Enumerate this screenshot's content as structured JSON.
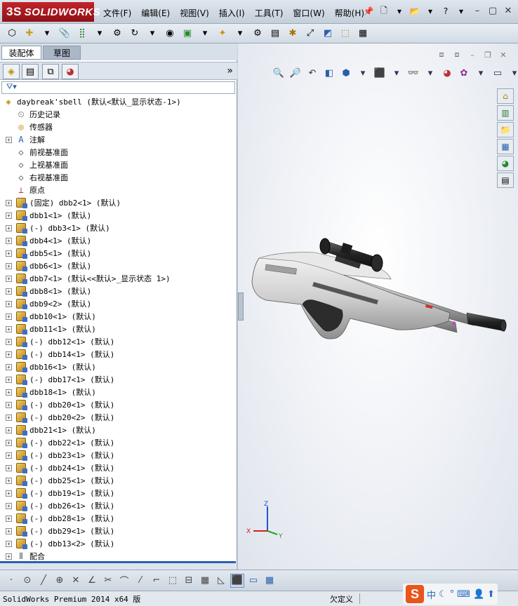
{
  "app": {
    "logo_text": "SOLIDWORKS",
    "logo_prefix": "3S"
  },
  "menu": [
    "文件(F)",
    "编辑(E)",
    "视图(V)",
    "插入(I)",
    "工具(T)",
    "窗口(W)",
    "帮助(H)"
  ],
  "tabs": {
    "assembly": "装配体",
    "sketch": "草图"
  },
  "filter_icon": "funnel-icon",
  "tree": {
    "root": "daybreak'sbell  (默认<默认_显示状态-1>)",
    "fixed_items": [
      {
        "label": "历史记录",
        "icon": "history-icon"
      },
      {
        "label": "传感器",
        "icon": "sensor-icon"
      },
      {
        "label": "注解",
        "icon": "annotation-icon"
      },
      {
        "label": "前视基准面",
        "icon": "plane-icon"
      },
      {
        "label": "上视基准面",
        "icon": "plane-icon"
      },
      {
        "label": "右视基准面",
        "icon": "plane-icon"
      },
      {
        "label": "原点",
        "icon": "origin-icon"
      }
    ],
    "components": [
      "(固定) dbb2<1> (默认)",
      "dbb1<1> (默认)",
      "(-) dbb3<1> (默认)",
      "dbb4<1> (默认)",
      "dbb5<1> (默认)",
      "dbb6<1> (默认)",
      "dbb7<1> (默认<<默认>_显示状态 1>)",
      "dbb8<1> (默认)",
      "dbb9<2> (默认)",
      "dbb10<1> (默认)",
      "dbb11<1> (默认)",
      "(-) dbb12<1> (默认)",
      "(-) dbb14<1> (默认)",
      "dbb16<1> (默认)",
      "(-) dbb17<1> (默认)",
      "dbb18<1> (默认)",
      "(-) dbb20<1> (默认)",
      "(-) dbb20<2> (默认)",
      "dbb21<1> (默认)",
      "(-) dbb22<1> (默认)",
      "(-) dbb23<1> (默认)",
      "(-) dbb24<1> (默认)",
      "(-) dbb25<1> (默认)",
      "(-) dbb19<1> (默认)",
      "(-) dbb26<1> (默认)",
      "(-) dbb28<1> (默认)",
      "(-) dbb29<1> (默认)",
      "(-) dbb13<2> (默认)"
    ],
    "mates": "配合"
  },
  "triad": {
    "x": "X",
    "y": "Y",
    "z": "Z"
  },
  "status": {
    "product": "SolidWorks Premium 2014 x64 版",
    "state": "欠定义"
  },
  "ime": {
    "logo": "S",
    "mode": "中"
  }
}
